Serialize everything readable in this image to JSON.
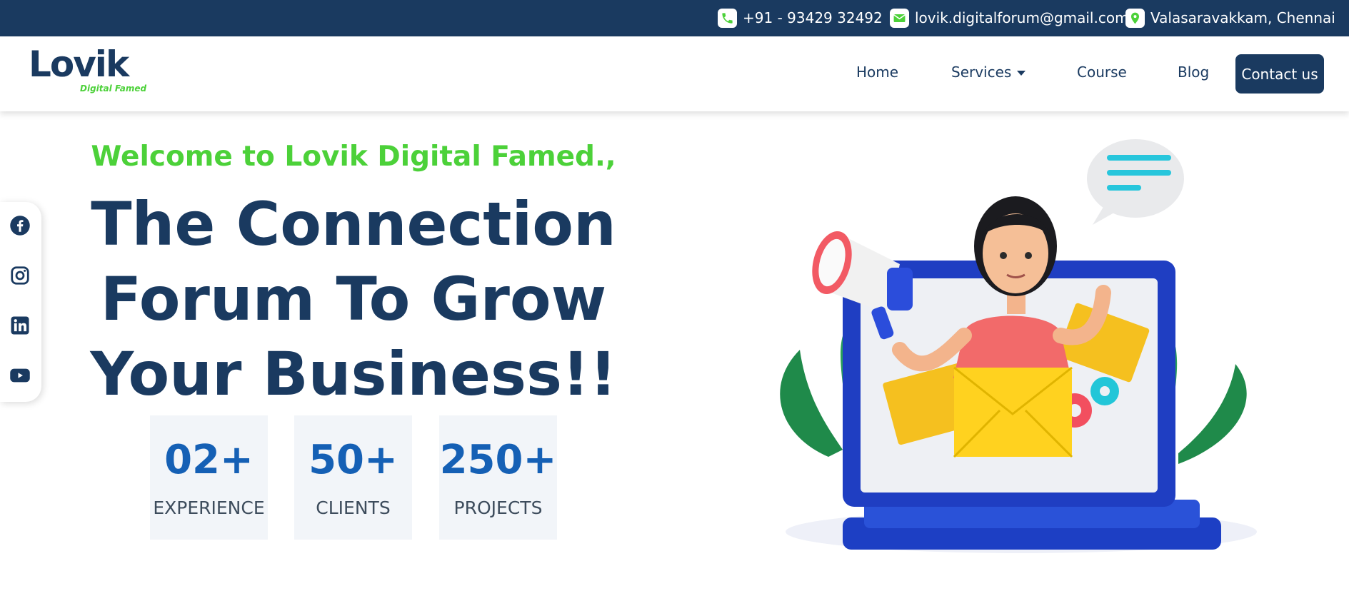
{
  "topbar": {
    "phone": "+91 - 93429 32492",
    "email": "lovik.digitalforum@gmail.com",
    "location": "Valasaravakkam, Chennai",
    "icons": [
      "phone-icon",
      "email-icon",
      "location-pin-icon"
    ]
  },
  "brand": {
    "logo_main": "Lovik",
    "logo_sub": "Digital Famed"
  },
  "nav": {
    "home": "Home",
    "services": "Services",
    "course": "Course",
    "blog": "Blog",
    "contact": "Contact us"
  },
  "social": [
    "facebook-icon",
    "instagram-icon",
    "linkedin-icon",
    "youtube-icon"
  ],
  "hero": {
    "welcome": "Welcome to Lovik Digital Famed.,",
    "headline_line1": "The Connection",
    "headline_line2": "Forum To Grow",
    "headline_line3": "Your Business!!"
  },
  "stats": [
    {
      "value": "02+",
      "label": "EXPERIENCE"
    },
    {
      "value": "50+",
      "label": "CLIENTS"
    },
    {
      "value": "250+",
      "label": "PROJECTS"
    }
  ],
  "colors": {
    "navy": "#1a3a60",
    "green": "#4cd139",
    "stat_blue": "#1560b5",
    "stat_bg": "#f2f5f9"
  }
}
